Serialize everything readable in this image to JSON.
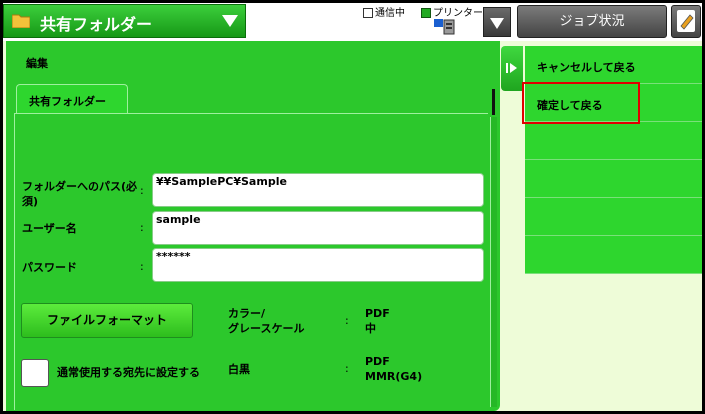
{
  "header": {
    "mode": "共有フォルダー",
    "status_comm": "通信中",
    "status_printer": "プリンター",
    "job_status": "ジョブ状況"
  },
  "main": {
    "title": "編集",
    "tab": "共有フォルダー",
    "fields": [
      {
        "label": "フォルダーへのパス(必須)",
        "value": "¥¥SamplePC¥Sample"
      },
      {
        "label": "ユーザー名",
        "value": "sample"
      },
      {
        "label": "パスワード",
        "value": "******"
      }
    ],
    "file_format_button": "ファイルフォーマット",
    "color_label_1": "カラー/",
    "color_label_2": "グレースケール",
    "color_value_1": "PDF",
    "color_value_2": "中",
    "bw_label": "白黒",
    "bw_value_1": "PDF",
    "bw_value_2": "MMR(G4)",
    "default_dest_label": "通常使用する宛先に設定する",
    "colon": ":"
  },
  "side_menu": {
    "items": [
      "キャンセルして戻る",
      "確定して戻る",
      "",
      "",
      "",
      ""
    ]
  },
  "colors": {
    "accent_green": "#2ed62e",
    "highlight": "#e00000"
  }
}
